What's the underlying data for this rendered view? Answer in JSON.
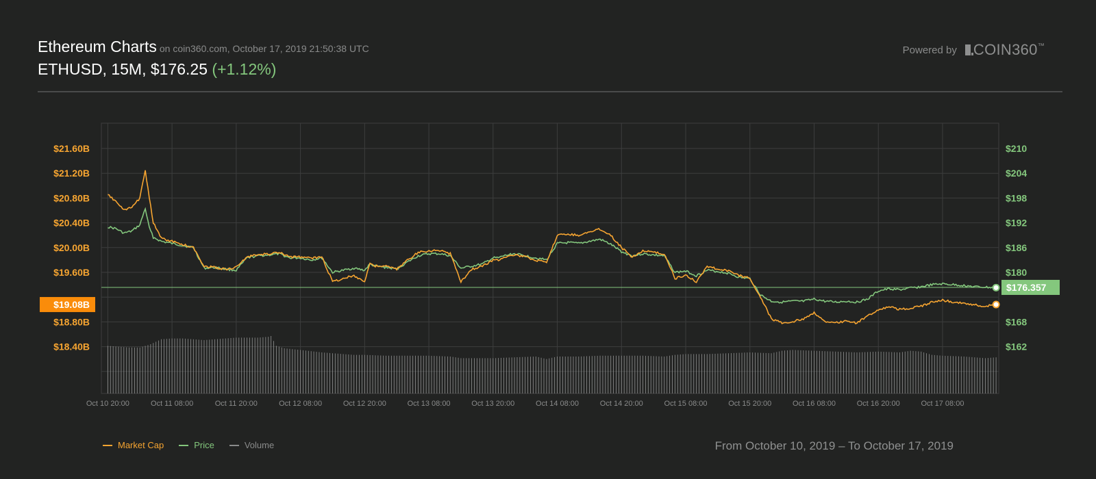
{
  "header": {
    "title": "Ethereum Charts",
    "source": "on coin360.com, October 17, 2019 21:50:38 UTC",
    "pair_info": "ETHUSD, 15M, $176.25",
    "change": "(+1.12%)",
    "powered_by": "Powered by",
    "brand": "COIN360",
    "brand_tm": "™"
  },
  "footer": {
    "range": "From October 10, 2019 – To October 17, 2019"
  },
  "colors": {
    "background": "#222322",
    "market_cap": "#f7a531",
    "price": "#84c77d",
    "volume": "#8a8b8b",
    "grid": "#3d3e3e"
  },
  "chart_data": {
    "type": "line",
    "title": "",
    "xlabel": "",
    "x_ticks": [
      "Oct 10 20:00",
      "Oct 11 08:00",
      "Oct 11 20:00",
      "Oct 12 08:00",
      "Oct 12 20:00",
      "Oct 13 08:00",
      "Oct 13 20:00",
      "Oct 14 08:00",
      "Oct 14 20:00",
      "Oct 15 08:00",
      "Oct 15 20:00",
      "Oct 16 08:00",
      "Oct 16 20:00",
      "Oct 17 08:00"
    ],
    "x_range_hours": [
      -1.2,
      166.5
    ],
    "left_axis": {
      "label": "",
      "ticks": [
        "$21.60B",
        "$21.20B",
        "$20.80B",
        "$20.40B",
        "$20.00B",
        "$19.60B",
        "$18.80B",
        "$18.40B"
      ],
      "tick_values": [
        21.6,
        21.2,
        20.8,
        20.4,
        20.0,
        19.6,
        18.8,
        18.4
      ],
      "unit": "B USD"
    },
    "right_axis": {
      "label": "",
      "ticks": [
        "$210",
        "$204",
        "$198",
        "$192",
        "$186",
        "$180",
        "$168",
        "$162"
      ],
      "tick_values": [
        210,
        204,
        198,
        192,
        186,
        180,
        168,
        162
      ],
      "unit": "USD"
    },
    "legend_position": "bottom-left",
    "grid": true,
    "current_market_cap_label": "$19.08B",
    "current_price_label": "$176.357",
    "current_price": 176.357,
    "series": [
      {
        "name": "Market Cap",
        "axis": "left",
        "x": [
          0,
          1.5,
          3,
          4.5,
          6,
          7,
          7.7,
          8.5,
          10,
          12,
          14,
          16,
          18,
          20,
          22,
          24,
          26,
          28,
          30,
          32,
          34,
          36,
          38,
          40,
          42,
          44,
          46,
          48,
          49,
          50,
          52,
          54,
          56,
          58,
          60,
          62,
          64,
          66,
          68,
          70,
          72,
          73,
          74,
          76,
          78,
          80,
          82,
          84,
          86,
          88,
          90,
          92,
          94,
          96,
          98,
          100,
          102,
          104,
          106,
          108,
          110,
          112,
          114,
          116,
          118,
          120,
          122,
          124,
          126,
          128,
          130,
          132,
          134,
          136,
          138,
          140,
          142,
          144,
          146,
          148,
          150,
          152,
          154,
          156,
          158,
          160,
          162,
          164,
          166
        ],
        "y": [
          20.85,
          20.75,
          20.6,
          20.65,
          20.8,
          21.25,
          20.85,
          20.4,
          20.15,
          20.1,
          20.05,
          20.0,
          19.7,
          19.68,
          19.65,
          19.68,
          19.85,
          19.88,
          19.9,
          19.92,
          19.85,
          19.85,
          19.83,
          19.85,
          19.45,
          19.5,
          19.55,
          19.45,
          19.75,
          19.7,
          19.7,
          19.65,
          19.8,
          19.92,
          19.95,
          19.95,
          19.9,
          19.45,
          19.65,
          19.7,
          19.8,
          19.8,
          19.85,
          19.88,
          19.85,
          19.8,
          19.75,
          20.2,
          20.22,
          20.2,
          20.25,
          20.3,
          20.2,
          20.0,
          19.85,
          19.95,
          19.92,
          19.9,
          19.5,
          19.55,
          19.45,
          19.7,
          19.65,
          19.62,
          19.55,
          19.5,
          19.2,
          18.85,
          18.78,
          18.8,
          18.85,
          18.95,
          18.8,
          18.78,
          18.82,
          18.78,
          18.9,
          19.0,
          19.05,
          19.0,
          19.02,
          19.05,
          19.12,
          19.15,
          19.12,
          19.1,
          19.08,
          19.05,
          19.08
        ]
      },
      {
        "name": "Price",
        "axis": "right",
        "x": [
          0,
          1.5,
          3,
          4.5,
          6,
          7,
          7.7,
          8.5,
          10,
          12,
          14,
          16,
          18,
          20,
          22,
          24,
          26,
          28,
          30,
          32,
          34,
          36,
          38,
          40,
          42,
          44,
          46,
          48,
          49,
          50,
          52,
          54,
          56,
          58,
          60,
          62,
          64,
          66,
          68,
          70,
          72,
          73,
          74,
          76,
          78,
          80,
          82,
          84,
          86,
          88,
          90,
          92,
          94,
          96,
          98,
          100,
          102,
          104,
          106,
          108,
          110,
          112,
          114,
          116,
          118,
          120,
          122,
          124,
          126,
          128,
          130,
          132,
          134,
          136,
          138,
          140,
          142,
          144,
          146,
          148,
          150,
          152,
          154,
          156,
          158,
          160,
          162,
          164,
          166
        ],
        "y": [
          191.0,
          190.6,
          189.5,
          190.0,
          191.5,
          195.5,
          191.0,
          188.5,
          187.5,
          187.0,
          186.5,
          186.0,
          181.0,
          181.2,
          180.8,
          180.5,
          183.5,
          184.0,
          184.2,
          184.5,
          183.5,
          183.5,
          183.0,
          183.5,
          180.0,
          180.5,
          181.0,
          180.5,
          182.0,
          181.5,
          181.2,
          180.8,
          182.5,
          184.0,
          184.5,
          184.5,
          184.0,
          181.0,
          181.5,
          182.0,
          183.5,
          183.5,
          184.0,
          184.5,
          184.0,
          183.5,
          183.0,
          187.0,
          187.2,
          187.0,
          187.5,
          188.0,
          186.8,
          185.0,
          184.0,
          184.5,
          184.2,
          184.0,
          180.0,
          180.3,
          179.2,
          180.5,
          180.2,
          179.8,
          178.8,
          178.5,
          174.5,
          173.0,
          172.8,
          173.0,
          173.0,
          173.5,
          173.0,
          172.8,
          173.0,
          172.8,
          173.5,
          175.5,
          176.0,
          175.8,
          176.2,
          176.5,
          177.0,
          177.2,
          177.0,
          176.8,
          176.5,
          176.4,
          176.3
        ]
      },
      {
        "name": "Volume",
        "axis": "none",
        "x": [
          0,
          4,
          6,
          8,
          10,
          12,
          14,
          16,
          18,
          20,
          22,
          24,
          26,
          28,
          30,
          30.5,
          31.5,
          33,
          36,
          40,
          44,
          46,
          48,
          52,
          56,
          60,
          64,
          66,
          68,
          72,
          76,
          80,
          82,
          84,
          88,
          92,
          96,
          100,
          104,
          106,
          108,
          112,
          116,
          120,
          124,
          126,
          128,
          132,
          136,
          140,
          144,
          148,
          150,
          152,
          154,
          156,
          160,
          164,
          166
        ],
        "y": [
          0.58,
          0.56,
          0.56,
          0.6,
          0.66,
          0.67,
          0.67,
          0.66,
          0.65,
          0.66,
          0.67,
          0.68,
          0.68,
          0.68,
          0.69,
          0.7,
          0.58,
          0.55,
          0.53,
          0.5,
          0.48,
          0.47,
          0.47,
          0.46,
          0.46,
          0.46,
          0.45,
          0.43,
          0.43,
          0.43,
          0.44,
          0.45,
          0.42,
          0.45,
          0.45,
          0.46,
          0.46,
          0.46,
          0.45,
          0.47,
          0.48,
          0.48,
          0.49,
          0.5,
          0.49,
          0.52,
          0.53,
          0.52,
          0.51,
          0.5,
          0.51,
          0.5,
          0.52,
          0.51,
          0.47,
          0.46,
          0.45,
          0.43,
          0.44
        ]
      }
    ]
  }
}
